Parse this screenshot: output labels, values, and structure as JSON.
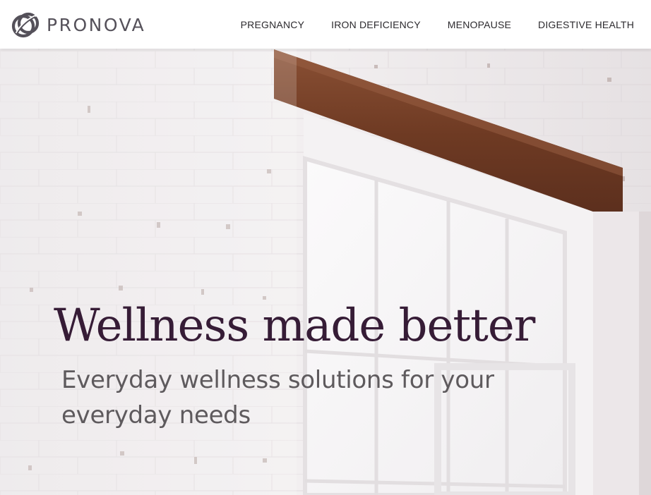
{
  "brand": {
    "name": "PRONOVA",
    "logo_icon": "interlocking-rings-icon",
    "logo_color": "#55515a"
  },
  "nav": {
    "items": [
      {
        "label": "PREGNANCY"
      },
      {
        "label": "IRON DEFICIENCY"
      },
      {
        "label": "MENOPAUSE"
      },
      {
        "label": "DIGESTIVE HEALTH"
      }
    ]
  },
  "hero": {
    "headline": "Wellness made better",
    "subheadline": "Everyday wellness solutions for your everyday needs",
    "headline_color": "#361c36",
    "subheadline_color": "#5e5a5d",
    "background": "white painted brick wall with window and wooden beam"
  }
}
